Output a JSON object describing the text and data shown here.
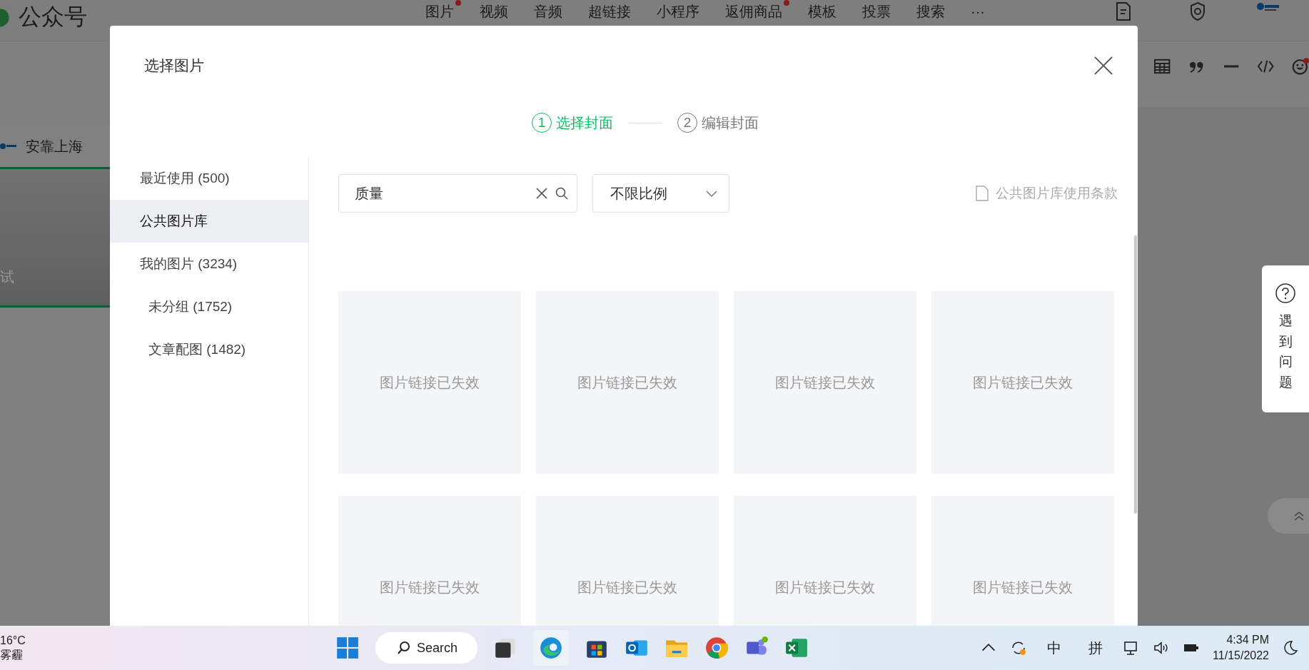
{
  "background": {
    "app_title": "公众号",
    "toolbar": [
      {
        "label": "图片",
        "dot": true
      },
      {
        "label": "视频",
        "dot": false
      },
      {
        "label": "音频",
        "dot": false
      },
      {
        "label": "超链接",
        "dot": false
      },
      {
        "label": "小程序",
        "dot": false
      },
      {
        "label": "返佣商品",
        "dot": true
      },
      {
        "label": "模板",
        "dot": false
      },
      {
        "label": "投票",
        "dot": false
      },
      {
        "label": "搜索",
        "dot": false
      },
      {
        "label": "···",
        "dot": false
      }
    ],
    "account": "安靠上海",
    "draft_title": "试",
    "help": "遇到问题"
  },
  "dialog": {
    "title": "选择图片",
    "steps": [
      {
        "number": "1",
        "label": "选择封面",
        "selected": true
      },
      {
        "number": "2",
        "label": "编辑封面",
        "selected": false
      }
    ],
    "sidebar": {
      "items": [
        {
          "label": "最近使用 (500)",
          "selected": false
        },
        {
          "label": "公共图片库",
          "selected": true
        },
        {
          "label": "我的图片 (3234)",
          "selected": false,
          "children": [
            {
              "label": "未分组 (1752)",
              "selected": false
            },
            {
              "label": "文章配图 (1482)",
              "selected": false
            }
          ]
        }
      ]
    },
    "search": {
      "value": "质量"
    },
    "ratio_select": {
      "value": "不限比例"
    },
    "terms_link": "公共图片库使用条款",
    "images": [
      {
        "status": "图片链接已失效"
      },
      {
        "status": "图片链接已失效"
      },
      {
        "status": "图片链接已失效"
      },
      {
        "status": "图片链接已失效"
      },
      {
        "status": "图片链接已失效"
      },
      {
        "status": "图片链接已失效"
      },
      {
        "status": "图片链接已失效"
      },
      {
        "status": "图片链接已失效"
      }
    ]
  },
  "taskbar": {
    "weather_temp": "16°C",
    "weather_desc": "雾霾",
    "search": "Search",
    "tray": [
      "中",
      "拼"
    ],
    "time": "4:34 PM",
    "date": "11/15/2022"
  }
}
